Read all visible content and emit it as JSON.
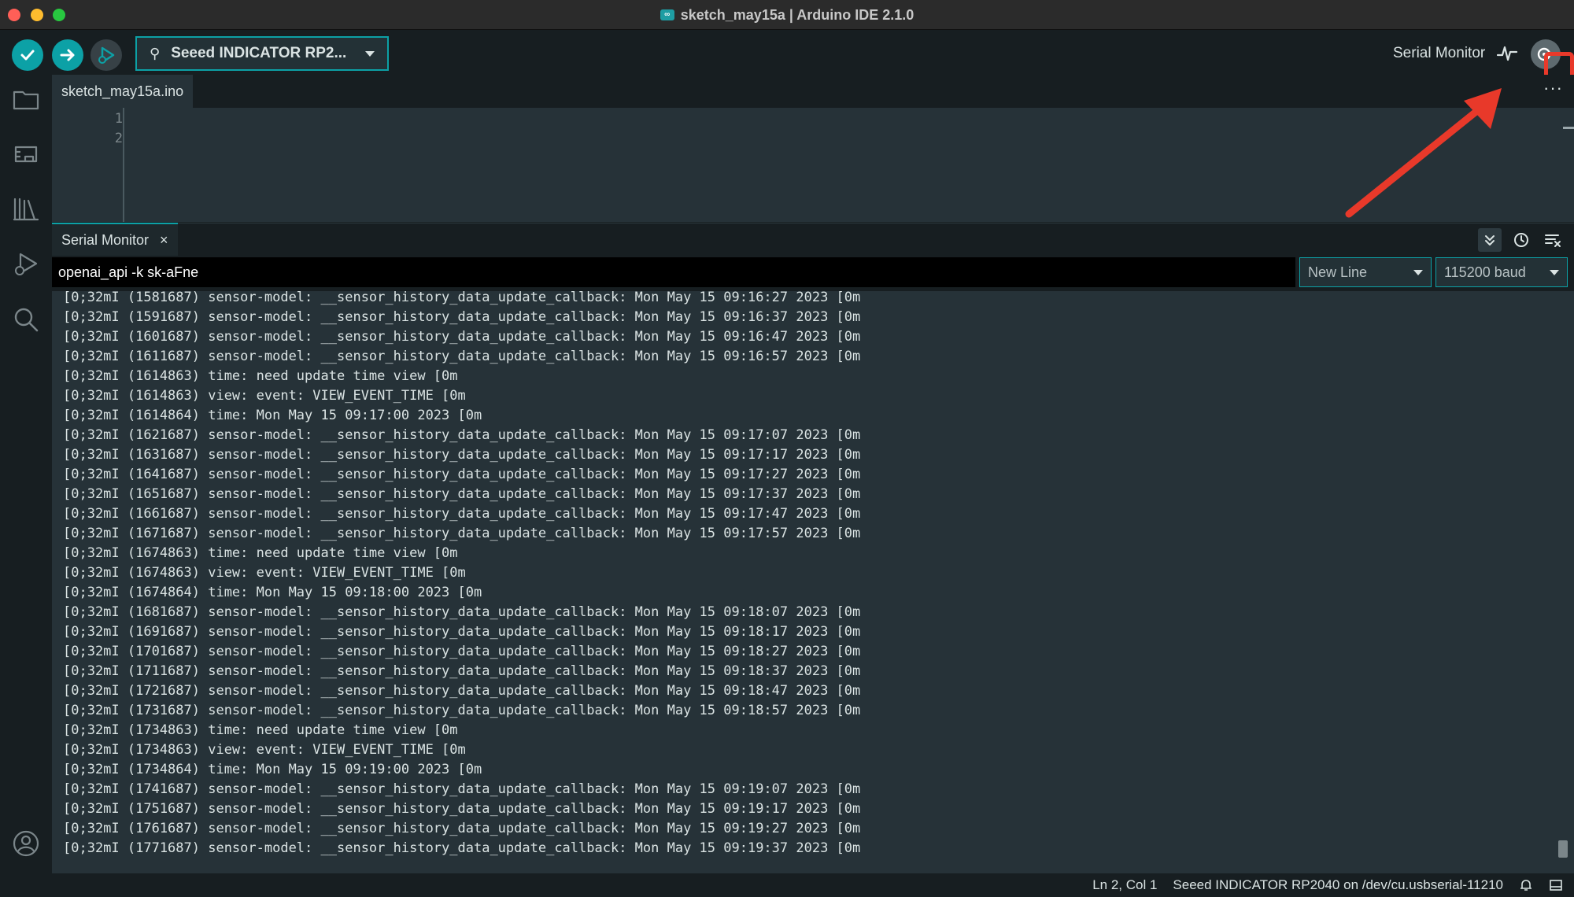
{
  "window": {
    "title": "sketch_may15a | Arduino IDE 2.1.0"
  },
  "toolbar": {
    "board_label": "Seeed INDICATOR RP2...",
    "serial_monitor_label": "Serial Monitor"
  },
  "editor": {
    "tab_label": "sketch_may15a.ino",
    "more_label": "···",
    "line_numbers": [
      "1",
      "2"
    ]
  },
  "serial_monitor": {
    "tab_label": "Serial Monitor",
    "close_label": "×",
    "input_value": "openai_api -k sk-aFne",
    "line_ending": "New Line",
    "baud_rate": "115200 baud",
    "lines": [
      "[0;32mI (1581687) sensor-model: __sensor_history_data_update_callback: Mon May 15 09:16:27 2023 [0m",
      "[0;32mI (1591687) sensor-model: __sensor_history_data_update_callback: Mon May 15 09:16:37 2023 [0m",
      "[0;32mI (1601687) sensor-model: __sensor_history_data_update_callback: Mon May 15 09:16:47 2023 [0m",
      "[0;32mI (1611687) sensor-model: __sensor_history_data_update_callback: Mon May 15 09:16:57 2023 [0m",
      "[0;32mI (1614863) time: need update time view [0m",
      "[0;32mI (1614863) view: event: VIEW_EVENT_TIME [0m",
      "[0;32mI (1614864) time: Mon May 15 09:17:00 2023 [0m",
      "[0;32mI (1621687) sensor-model: __sensor_history_data_update_callback: Mon May 15 09:17:07 2023 [0m",
      "[0;32mI (1631687) sensor-model: __sensor_history_data_update_callback: Mon May 15 09:17:17 2023 [0m",
      "[0;32mI (1641687) sensor-model: __sensor_history_data_update_callback: Mon May 15 09:17:27 2023 [0m",
      "[0;32mI (1651687) sensor-model: __sensor_history_data_update_callback: Mon May 15 09:17:37 2023 [0m",
      "[0;32mI (1661687) sensor-model: __sensor_history_data_update_callback: Mon May 15 09:17:47 2023 [0m",
      "[0;32mI (1671687) sensor-model: __sensor_history_data_update_callback: Mon May 15 09:17:57 2023 [0m",
      "[0;32mI (1674863) time: need update time view [0m",
      "[0;32mI (1674863) view: event: VIEW_EVENT_TIME [0m",
      "[0;32mI (1674864) time: Mon May 15 09:18:00 2023 [0m",
      "[0;32mI (1681687) sensor-model: __sensor_history_data_update_callback: Mon May 15 09:18:07 2023 [0m",
      "[0;32mI (1691687) sensor-model: __sensor_history_data_update_callback: Mon May 15 09:18:17 2023 [0m",
      "[0;32mI (1701687) sensor-model: __sensor_history_data_update_callback: Mon May 15 09:18:27 2023 [0m",
      "[0;32mI (1711687) sensor-model: __sensor_history_data_update_callback: Mon May 15 09:18:37 2023 [0m",
      "[0;32mI (1721687) sensor-model: __sensor_history_data_update_callback: Mon May 15 09:18:47 2023 [0m",
      "[0;32mI (1731687) sensor-model: __sensor_history_data_update_callback: Mon May 15 09:18:57 2023 [0m",
      "[0;32mI (1734863) time: need update time view [0m",
      "[0;32mI (1734863) view: event: VIEW_EVENT_TIME [0m",
      "[0;32mI (1734864) time: Mon May 15 09:19:00 2023 [0m",
      "[0;32mI (1741687) sensor-model: __sensor_history_data_update_callback: Mon May 15 09:19:07 2023 [0m",
      "[0;32mI (1751687) sensor-model: __sensor_history_data_update_callback: Mon May 15 09:19:17 2023 [0m",
      "[0;32mI (1761687) sensor-model: __sensor_history_data_update_callback: Mon May 15 09:19:27 2023 [0m",
      "[0;32mI (1771687) sensor-model: __sensor_history_data_update_callback: Mon May 15 09:19:37 2023 [0m"
    ]
  },
  "status_bar": {
    "cursor_position": "Ln 2, Col 1",
    "board_port": "Seeed INDICATOR RP2040 on /dev/cu.usbserial-11210"
  },
  "colors": {
    "accent": "#0ca1a6",
    "background": "#171e21",
    "panel": "#263238",
    "highlight": "#e8392a"
  }
}
